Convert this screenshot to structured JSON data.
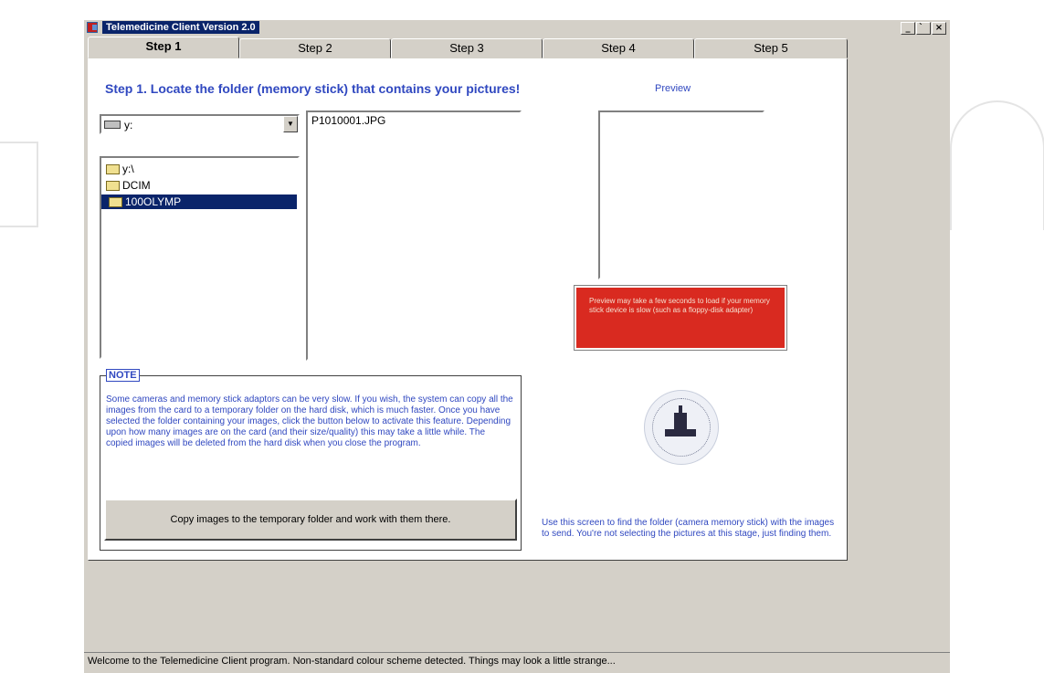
{
  "window": {
    "title": "Telemedicine Client Version 2.0"
  },
  "window_buttons": {
    "minimize": "_",
    "maximize": "̀",
    "close": "×"
  },
  "tabs": [
    {
      "label": "Step 1"
    },
    {
      "label": "Step 2"
    },
    {
      "label": "Step 3"
    },
    {
      "label": "Step 4"
    },
    {
      "label": "Step 5"
    }
  ],
  "step": {
    "heading": "Step 1. Locate the folder (memory stick) that contains your pictures!",
    "preview_label": "Preview"
  },
  "drive_select": {
    "value": "y:"
  },
  "folder_tree": {
    "items": [
      {
        "label": "y:\\"
      },
      {
        "label": "DCIM"
      },
      {
        "label": "100OLYMP"
      }
    ],
    "selected": "100OLYMP"
  },
  "file_list": {
    "items": [
      "P1010001.JPG"
    ]
  },
  "preview_warning": "Preview may take a few seconds to load if your memory stick device is slow (such as a floppy-disk adapter)",
  "note": {
    "legend": "NOTE",
    "text": "Some cameras and memory stick adaptors can be very slow. If you wish, the system can copy all the images from the card to a temporary folder on the hard disk, which is much faster. Once you have selected the folder containing your images, click the button below to activate this feature. Depending upon how many images are on the card (and their size/quality) this may take a little while. The copied images will be deleted from the hard disk when you close the program.",
    "button": "Copy images to the temporary folder and work with them there."
  },
  "info_text": "Use this screen to find the folder (camera memory stick) with the images to send. You're not selecting the pictures at this stage, just finding them.",
  "status_bar": "Welcome to the Telemedicine Client program. Non-standard colour scheme detected. Things may look a little strange...",
  "colors": {
    "accent_text": "#3048c0",
    "warning_bg": "#d92a20",
    "selection": "#0a246a",
    "window_face": "#d4d0c8"
  },
  "icons": [
    "app-icon",
    "drive-icon",
    "folder-icon",
    "dropdown-arrow-icon",
    "seal-logo"
  ]
}
